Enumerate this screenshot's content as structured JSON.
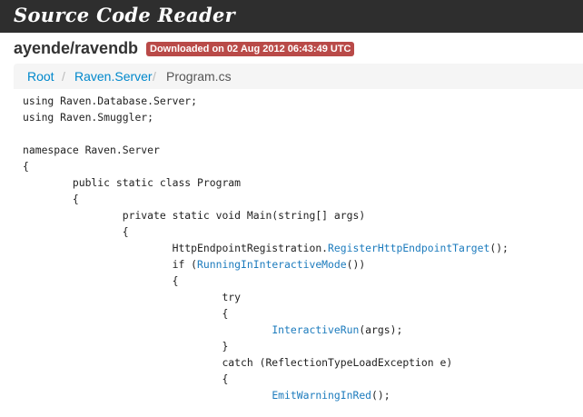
{
  "header": {
    "app_title": "Source Code Reader"
  },
  "repo": {
    "name": "ayende/ravendb",
    "download_badge": "Downloaded on 02 Aug 2012 06:43:49 UTC"
  },
  "breadcrumb": {
    "items": [
      "Root",
      "Raven.Server",
      "Program.cs"
    ],
    "separator": "/"
  },
  "code": {
    "lines": [
      [
        {
          "t": "using Raven.Database.Server;"
        }
      ],
      [
        {
          "t": "using Raven.Smuggler;"
        }
      ],
      [
        {
          "t": ""
        }
      ],
      [
        {
          "t": "namespace Raven.Server"
        }
      ],
      [
        {
          "t": "{"
        }
      ],
      [
        {
          "t": "        public static class Program"
        }
      ],
      [
        {
          "t": "        {"
        }
      ],
      [
        {
          "t": "                private static void Main(string[] args)"
        }
      ],
      [
        {
          "t": "                {"
        }
      ],
      [
        {
          "t": "                        HttpEndpointRegistration."
        },
        {
          "t": "RegisterHttpEndpointTarget",
          "k": "method"
        },
        {
          "t": "();"
        }
      ],
      [
        {
          "t": "                        if ("
        },
        {
          "t": "RunningInInteractiveMode",
          "k": "method"
        },
        {
          "t": "())"
        }
      ],
      [
        {
          "t": "                        {"
        }
      ],
      [
        {
          "t": "                                try"
        }
      ],
      [
        {
          "t": "                                {"
        }
      ],
      [
        {
          "t": "                                        "
        },
        {
          "t": "InteractiveRun",
          "k": "method"
        },
        {
          "t": "(args);"
        }
      ],
      [
        {
          "t": "                                }"
        }
      ],
      [
        {
          "t": "                                catch (ReflectionTypeLoadException e)"
        }
      ],
      [
        {
          "t": "                                {"
        }
      ],
      [
        {
          "t": "                                        "
        },
        {
          "t": "EmitWarningInRed",
          "k": "method"
        },
        {
          "t": "();"
        }
      ]
    ]
  },
  "colors": {
    "topbar_bg": "#2e2e2e",
    "badge_bg": "#b94a48",
    "link": "#0088cc",
    "code_method": "#1c7bbd"
  }
}
